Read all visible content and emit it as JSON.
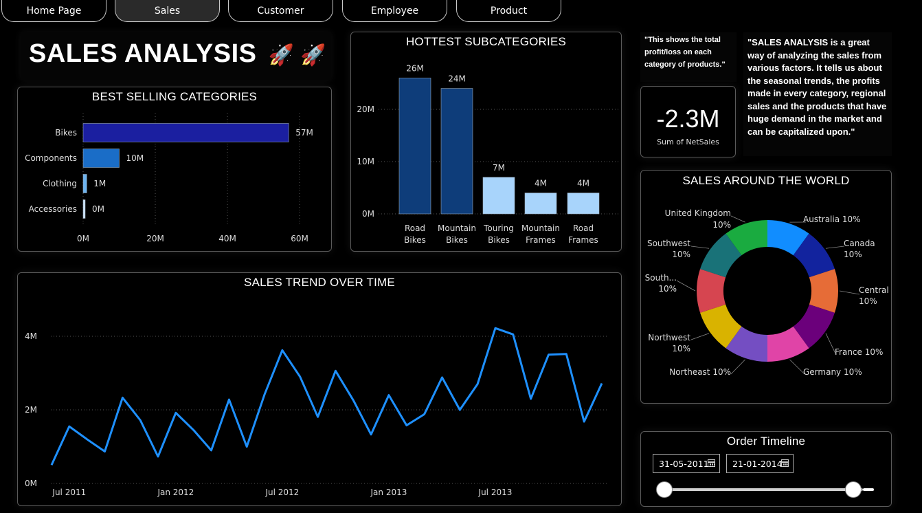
{
  "nav": {
    "items": [
      {
        "label": "Home Page"
      },
      {
        "label": "Sales"
      },
      {
        "label": "Customer"
      },
      {
        "label": "Employee"
      },
      {
        "label": "Product"
      }
    ],
    "active": "Sales"
  },
  "hero": {
    "title": "SALES ANALYSIS",
    "emoji": "🚀 🚀"
  },
  "best_selling": {
    "title": "BEST SELLING CATEGORIES",
    "chart_data": {
      "type": "bar",
      "orientation": "horizontal",
      "categories": [
        "Bikes",
        "Components",
        "Clothing",
        "Accessories"
      ],
      "values": [
        57,
        10,
        1,
        0
      ],
      "value_labels": [
        "57M",
        "10M",
        "1M",
        "0M"
      ],
      "xticks": [
        "0M",
        "20M",
        "40M",
        "60M"
      ],
      "xlim": [
        0,
        60
      ],
      "colors": [
        "#1b1fa0",
        "#1a6dc7",
        "#6bb3f0",
        "#cfe6fb"
      ]
    }
  },
  "hottest": {
    "title": "HOTTEST SUBCATEGORIES",
    "chart_data": {
      "type": "bar",
      "categories": [
        "Road Bikes",
        "Mountain Bikes",
        "Touring Bikes",
        "Mountain Frames",
        "Road Frames"
      ],
      "category_lines": [
        [
          "Road",
          "Bikes"
        ],
        [
          "Mountain",
          "Bikes"
        ],
        [
          "Touring",
          "Bikes"
        ],
        [
          "Mountain",
          "Frames"
        ],
        [
          "Road",
          "Frames"
        ]
      ],
      "values": [
        26,
        24,
        7,
        4,
        4
      ],
      "value_labels": [
        "26M",
        "24M",
        "7M",
        "4M",
        "4M"
      ],
      "yticks": [
        "0M",
        "10M",
        "20M"
      ],
      "ylim": [
        0,
        28
      ],
      "colors": [
        "#0e3d7a",
        "#0e3d7a",
        "#a8d4fb",
        "#a8d4fb",
        "#a8d4fb"
      ]
    }
  },
  "note_small": "\"This shows the total profit/loss on each category of products.\"",
  "note_big": "\"SALES ANALYSIS is a great way of analyzing the sales from various factors. It tells us about the seasonal trends, the profits made in every category, regional sales and the products that have huge demand in the market and can be capitalized upon.\"",
  "kpi": {
    "value": "-2.3M",
    "label": "Sum of NetSales"
  },
  "world": {
    "title": "SALES AROUND THE WORLD",
    "chart_data": {
      "type": "pie",
      "donut": true,
      "categories": [
        "Australia",
        "Canada",
        "Central",
        "France",
        "Germany",
        "Northeast",
        "Northwest",
        "South...",
        "Southwest",
        "United Kingdom"
      ],
      "values": [
        10,
        10,
        10,
        10,
        10,
        10,
        10,
        10,
        10,
        10
      ],
      "labels": [
        {
          "name": "Australia",
          "pct": "10%"
        },
        {
          "name": "Canada",
          "pct": "10%"
        },
        {
          "name": "Central",
          "pct": "10%"
        },
        {
          "name": "France",
          "pct": "10%"
        },
        {
          "name": "Germany",
          "pct": "10%"
        },
        {
          "name": "Northeast",
          "pct": "10%"
        },
        {
          "name": "Northwest",
          "pct": "10%"
        },
        {
          "name": "South...",
          "pct": "10%"
        },
        {
          "name": "Southwest",
          "pct": "10%"
        },
        {
          "name": "United Kingdom",
          "pct": "10%"
        }
      ],
      "colors": [
        "#118dff",
        "#12239e",
        "#e66c37",
        "#6b007b",
        "#e044a7",
        "#744ec2",
        "#d9b300",
        "#d64550",
        "#197278",
        "#1aab40"
      ]
    }
  },
  "trend": {
    "title": "SALES TREND OVER TIME",
    "chart_data": {
      "type": "line",
      "x": [
        "2011-06",
        "2011-07",
        "2011-08",
        "2011-09",
        "2011-10",
        "2011-11",
        "2011-12",
        "2012-01",
        "2012-02",
        "2012-03",
        "2012-04",
        "2012-05",
        "2012-06",
        "2012-07",
        "2012-08",
        "2012-09",
        "2012-10",
        "2012-11",
        "2012-12",
        "2013-01",
        "2013-02",
        "2013-03",
        "2013-04",
        "2013-05",
        "2013-06",
        "2013-07",
        "2013-08",
        "2013-09",
        "2013-10",
        "2013-11",
        "2013-12",
        "2014-01"
      ],
      "values": [
        0.5,
        1.55,
        1.2,
        0.87,
        2.33,
        1.72,
        0.73,
        1.92,
        1.45,
        0.9,
        2.28,
        1.0,
        2.42,
        3.62,
        2.9,
        1.81,
        3.06,
        2.26,
        1.33,
        2.4,
        1.58,
        1.88,
        2.88,
        2.0,
        2.7,
        4.22,
        4.05,
        2.3,
        3.5,
        3.52,
        1.68,
        2.72
      ],
      "xticks": [
        "Jul 2011",
        "Jan 2012",
        "Jul 2012",
        "Jan 2013",
        "Jul 2013"
      ],
      "yticks": [
        "0M",
        "2M",
        "4M"
      ],
      "ylim": [
        0,
        4.7
      ],
      "color": "#1e90ff"
    }
  },
  "timeline": {
    "title": "Order Timeline",
    "start": "31-05-2011",
    "end": "21-01-2014"
  }
}
